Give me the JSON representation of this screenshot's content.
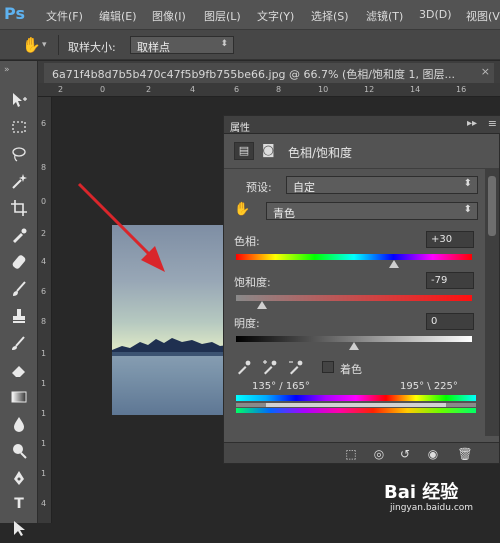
{
  "app": {
    "logo": "Ps"
  },
  "menubar": {
    "items": [
      "文件(F)",
      "编辑(E)",
      "图像(I)",
      "图层(L)",
      "文字(Y)",
      "选择(S)",
      "滤镜(T)",
      "3D(D)",
      "视图(V"
    ]
  },
  "options": {
    "label": "取样大小:",
    "sample_value": "取样点",
    "tool_icon": "hand-icon"
  },
  "document": {
    "tab_title": "6a71f4b8d7b5b470c47f5b9fb755be66.jpg @ 66.7% (色相/饱和度 1, 图层...",
    "close_glyph": "×"
  },
  "rulers": {
    "top": [
      "2",
      "0",
      "2",
      "4",
      "6",
      "8",
      "10",
      "12",
      "14",
      "16"
    ],
    "left": [
      "6",
      "8",
      "0",
      "2",
      "4",
      "6",
      "8",
      "1",
      "1",
      "1",
      "1",
      "1",
      "4"
    ]
  },
  "panel": {
    "tab": "属性",
    "title": "色相/饱和度",
    "preset_label": "预设:",
    "preset_value": "自定",
    "channel_value": "青色",
    "hue_label": "色相:",
    "hue_value": "+30",
    "hue_level": 0.67,
    "saturation_label": "饱和度:",
    "saturation_value": "-79",
    "saturation_level": 0.11,
    "lightness_label": "明度:",
    "lightness_value": "0",
    "lightness_level": 0.5,
    "colorize_label": "着色",
    "range_left": "135° / 165°",
    "range_right": "195° \\ 225°"
  },
  "watermark": {
    "brand": "Bai 经验",
    "url": "jingyan.baidu.com"
  },
  "colors": {
    "arrow": "#d9262b",
    "accent": "#5eb2f0"
  }
}
